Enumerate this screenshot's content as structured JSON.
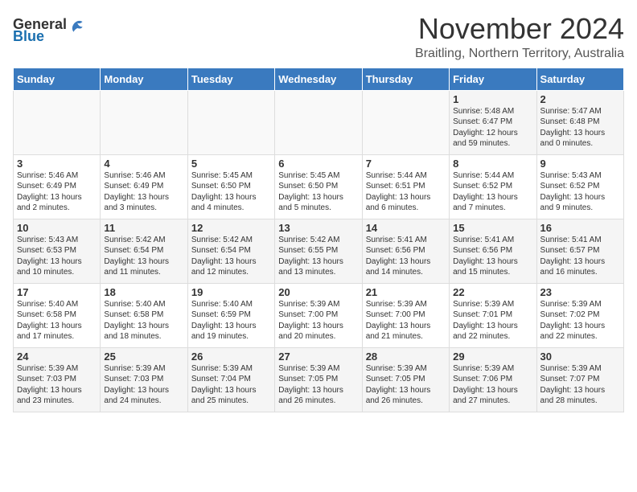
{
  "logo": {
    "general": "General",
    "blue": "Blue"
  },
  "title": "November 2024",
  "location": "Braitling, Northern Territory, Australia",
  "headers": [
    "Sunday",
    "Monday",
    "Tuesday",
    "Wednesday",
    "Thursday",
    "Friday",
    "Saturday"
  ],
  "weeks": [
    {
      "days": [
        {
          "number": "",
          "info": ""
        },
        {
          "number": "",
          "info": ""
        },
        {
          "number": "",
          "info": ""
        },
        {
          "number": "",
          "info": ""
        },
        {
          "number": "",
          "info": ""
        },
        {
          "number": "1",
          "info": "Sunrise: 5:48 AM\nSunset: 6:47 PM\nDaylight: 12 hours\nand 59 minutes."
        },
        {
          "number": "2",
          "info": "Sunrise: 5:47 AM\nSunset: 6:48 PM\nDaylight: 13 hours\nand 0 minutes."
        }
      ]
    },
    {
      "days": [
        {
          "number": "3",
          "info": "Sunrise: 5:46 AM\nSunset: 6:49 PM\nDaylight: 13 hours\nand 2 minutes."
        },
        {
          "number": "4",
          "info": "Sunrise: 5:46 AM\nSunset: 6:49 PM\nDaylight: 13 hours\nand 3 minutes."
        },
        {
          "number": "5",
          "info": "Sunrise: 5:45 AM\nSunset: 6:50 PM\nDaylight: 13 hours\nand 4 minutes."
        },
        {
          "number": "6",
          "info": "Sunrise: 5:45 AM\nSunset: 6:50 PM\nDaylight: 13 hours\nand 5 minutes."
        },
        {
          "number": "7",
          "info": "Sunrise: 5:44 AM\nSunset: 6:51 PM\nDaylight: 13 hours\nand 6 minutes."
        },
        {
          "number": "8",
          "info": "Sunrise: 5:44 AM\nSunset: 6:52 PM\nDaylight: 13 hours\nand 7 minutes."
        },
        {
          "number": "9",
          "info": "Sunrise: 5:43 AM\nSunset: 6:52 PM\nDaylight: 13 hours\nand 9 minutes."
        }
      ]
    },
    {
      "days": [
        {
          "number": "10",
          "info": "Sunrise: 5:43 AM\nSunset: 6:53 PM\nDaylight: 13 hours\nand 10 minutes."
        },
        {
          "number": "11",
          "info": "Sunrise: 5:42 AM\nSunset: 6:54 PM\nDaylight: 13 hours\nand 11 minutes."
        },
        {
          "number": "12",
          "info": "Sunrise: 5:42 AM\nSunset: 6:54 PM\nDaylight: 13 hours\nand 12 minutes."
        },
        {
          "number": "13",
          "info": "Sunrise: 5:42 AM\nSunset: 6:55 PM\nDaylight: 13 hours\nand 13 minutes."
        },
        {
          "number": "14",
          "info": "Sunrise: 5:41 AM\nSunset: 6:56 PM\nDaylight: 13 hours\nand 14 minutes."
        },
        {
          "number": "15",
          "info": "Sunrise: 5:41 AM\nSunset: 6:56 PM\nDaylight: 13 hours\nand 15 minutes."
        },
        {
          "number": "16",
          "info": "Sunrise: 5:41 AM\nSunset: 6:57 PM\nDaylight: 13 hours\nand 16 minutes."
        }
      ]
    },
    {
      "days": [
        {
          "number": "17",
          "info": "Sunrise: 5:40 AM\nSunset: 6:58 PM\nDaylight: 13 hours\nand 17 minutes."
        },
        {
          "number": "18",
          "info": "Sunrise: 5:40 AM\nSunset: 6:58 PM\nDaylight: 13 hours\nand 18 minutes."
        },
        {
          "number": "19",
          "info": "Sunrise: 5:40 AM\nSunset: 6:59 PM\nDaylight: 13 hours\nand 19 minutes."
        },
        {
          "number": "20",
          "info": "Sunrise: 5:39 AM\nSunset: 7:00 PM\nDaylight: 13 hours\nand 20 minutes."
        },
        {
          "number": "21",
          "info": "Sunrise: 5:39 AM\nSunset: 7:00 PM\nDaylight: 13 hours\nand 21 minutes."
        },
        {
          "number": "22",
          "info": "Sunrise: 5:39 AM\nSunset: 7:01 PM\nDaylight: 13 hours\nand 22 minutes."
        },
        {
          "number": "23",
          "info": "Sunrise: 5:39 AM\nSunset: 7:02 PM\nDaylight: 13 hours\nand 22 minutes."
        }
      ]
    },
    {
      "days": [
        {
          "number": "24",
          "info": "Sunrise: 5:39 AM\nSunset: 7:03 PM\nDaylight: 13 hours\nand 23 minutes."
        },
        {
          "number": "25",
          "info": "Sunrise: 5:39 AM\nSunset: 7:03 PM\nDaylight: 13 hours\nand 24 minutes."
        },
        {
          "number": "26",
          "info": "Sunrise: 5:39 AM\nSunset: 7:04 PM\nDaylight: 13 hours\nand 25 minutes."
        },
        {
          "number": "27",
          "info": "Sunrise: 5:39 AM\nSunset: 7:05 PM\nDaylight: 13 hours\nand 26 minutes."
        },
        {
          "number": "28",
          "info": "Sunrise: 5:39 AM\nSunset: 7:05 PM\nDaylight: 13 hours\nand 26 minutes."
        },
        {
          "number": "29",
          "info": "Sunrise: 5:39 AM\nSunset: 7:06 PM\nDaylight: 13 hours\nand 27 minutes."
        },
        {
          "number": "30",
          "info": "Sunrise: 5:39 AM\nSunset: 7:07 PM\nDaylight: 13 hours\nand 28 minutes."
        }
      ]
    }
  ]
}
